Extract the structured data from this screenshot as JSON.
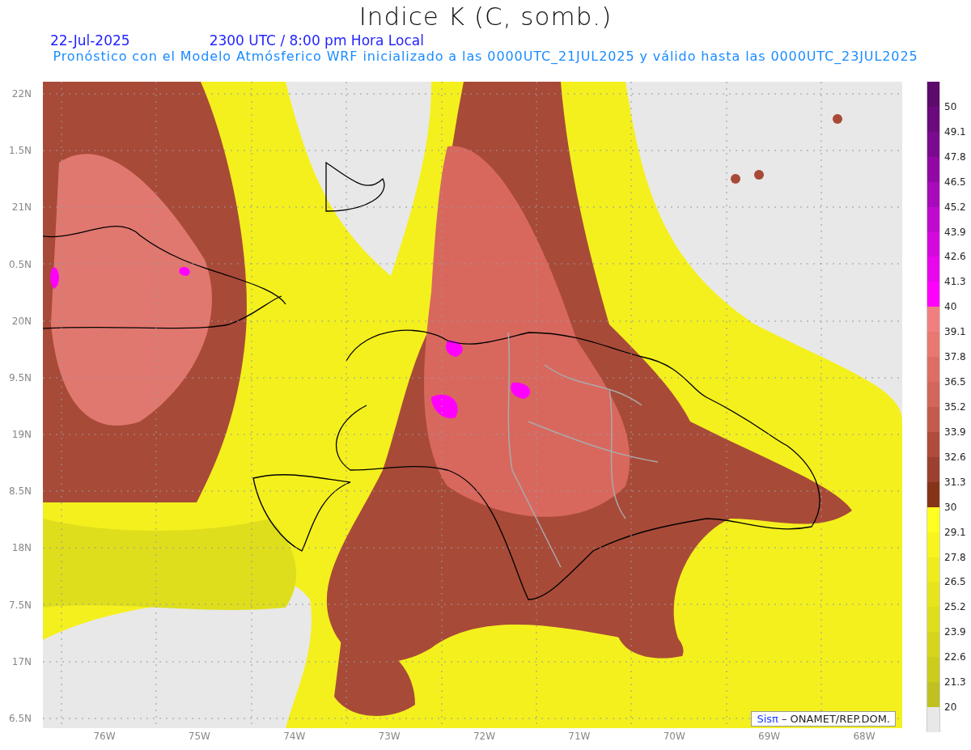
{
  "title": "Indice K (C, somb.)",
  "date": "22-Jul-2025",
  "time": "2300 UTC / 8:00 pm Hora Local",
  "subtitle": "Pronóstico con el Modelo Atmósferico WRF inicializado a las 0000UTC_21JUL2025 y válido hasta las  0000UTC_23JUL2025",
  "y_axis": [
    "22N",
    "1.5N",
    "21N",
    "0.5N",
    "20N",
    "9.5N",
    "19N",
    "8.5N",
    "18N",
    "7.5N",
    "17N",
    "6.5N"
  ],
  "x_axis": [
    "76W",
    "75W",
    "74W",
    "73W",
    "72W",
    "71W",
    "70W",
    "69W",
    "68W"
  ],
  "credit": {
    "logo": "Sisπ",
    "text": "– ONAMET/REP.DOM."
  },
  "colorbar": [
    {
      "color": "#5c0a6c",
      "label": "50"
    },
    {
      "color": "#6a0a7c",
      "label": "49.1"
    },
    {
      "color": "#7c0a8e",
      "label": "47.8"
    },
    {
      "color": "#9208a4",
      "label": "46.5"
    },
    {
      "color": "#a80abc",
      "label": "45.2"
    },
    {
      "color": "#c00ad0",
      "label": "43.9"
    },
    {
      "color": "#d608e0",
      "label": "42.6"
    },
    {
      "color": "#e806ec",
      "label": "41.3"
    },
    {
      "color": "#ff00ff",
      "label": "40"
    },
    {
      "color": "#f08080",
      "label": "39.1"
    },
    {
      "color": "#e87870",
      "label": "37.8"
    },
    {
      "color": "#de6e64",
      "label": "36.5"
    },
    {
      "color": "#d2665a",
      "label": "35.2"
    },
    {
      "color": "#c45a4c",
      "label": "33.9"
    },
    {
      "color": "#b04c3c",
      "label": "32.6"
    },
    {
      "color": "#9c4030",
      "label": "31.3"
    },
    {
      "color": "#863418",
      "label": "30"
    },
    {
      "color": "#ffff20",
      "label": "29.1"
    },
    {
      "color": "#f8f41e",
      "label": "27.8"
    },
    {
      "color": "#eeec1c",
      "label": "26.5"
    },
    {
      "color": "#e6e41c",
      "label": "25.2"
    },
    {
      "color": "#dede1c",
      "label": "23.9"
    },
    {
      "color": "#d6d41c",
      "label": "22.6"
    },
    {
      "color": "#cccc1c",
      "label": "21.3"
    },
    {
      "color": "#c0c020",
      "label": "20"
    },
    {
      "color": "#e8e8e8"
    }
  ]
}
